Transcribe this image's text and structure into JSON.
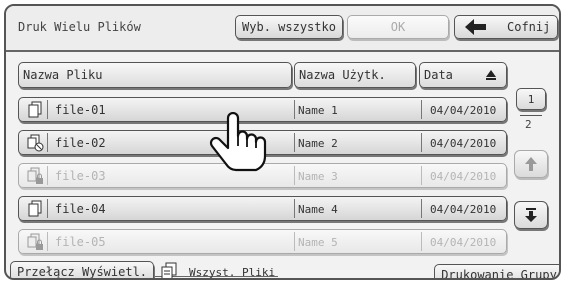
{
  "header": {
    "title": "Druk Wielu Plików",
    "select_all_label": "Wyb. wszystko",
    "ok_label": "OK",
    "back_label": "Cofnij"
  },
  "columns": {
    "file_name": "Nazwa Pliku",
    "user_name": "Nazwa Użytk.",
    "date": "Data"
  },
  "rows": [
    {
      "file": "file-01",
      "user": "Name 1",
      "date": "04/04/2010",
      "enabled": true,
      "icon": "document-icon"
    },
    {
      "file": "file-02",
      "user": "Name 2",
      "date": "04/04/2010",
      "enabled": true,
      "icon": "document-restricted-icon"
    },
    {
      "file": "file-03",
      "user": "Name 3",
      "date": "04/04/2010",
      "enabled": false,
      "icon": "document-locked-icon"
    },
    {
      "file": "file-04",
      "user": "Name 4",
      "date": "04/04/2010",
      "enabled": true,
      "icon": "document-icon"
    },
    {
      "file": "file-05",
      "user": "Name 5",
      "date": "04/04/2010",
      "enabled": false,
      "icon": "document-locked-icon"
    }
  ],
  "pagination": {
    "current": "1",
    "total": "2"
  },
  "footer": {
    "toggle_label": "Przełącz Wyświetl.",
    "all_files_label": "Wszyst. Pliki",
    "group_print_label": "Drukowanie Grupy"
  }
}
